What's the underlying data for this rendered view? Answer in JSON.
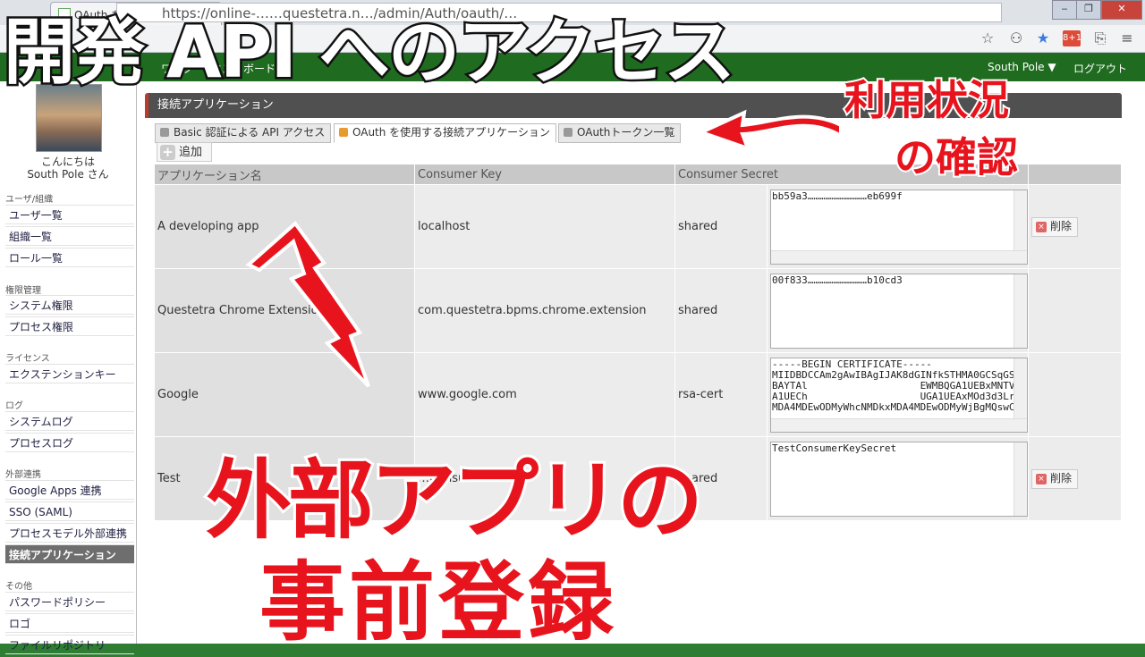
{
  "browser": {
    "tab_title": "OAuth を使用する接続ア",
    "tab_close": "×",
    "address": "https://online-……questetra.n…/admin/Auth/oauth/…",
    "window_controls": [
      "‒",
      "❐",
      "✕"
    ],
    "toolbar_icons": [
      "star-icon",
      "user-icon",
      "bookmark-star-icon",
      "gplus-icon",
      "translate-icon",
      "menu-icon"
    ],
    "gplus_label": "8+1"
  },
  "app": {
    "nav_partial": "ワーク",
    "nav_task": "タスクボード",
    "user_menu": "South Pole ▼",
    "logout": "ログアウト"
  },
  "sidebar": {
    "greeting_line1": "こんにちは",
    "greeting_line2": "South Pole さん",
    "sections": [
      {
        "title": "ユーザ/組織",
        "items": [
          "ユーザ一覧",
          "組織一覧",
          "ロール一覧"
        ]
      },
      {
        "title": "権限管理",
        "items": [
          "システム権限",
          "プロセス権限"
        ]
      },
      {
        "title": "ライセンス",
        "items": [
          "エクステンションキー"
        ]
      },
      {
        "title": "ログ",
        "items": [
          "システムログ",
          "プロセスログ"
        ]
      },
      {
        "title": "外部連携",
        "items": [
          "Google Apps 連携",
          "SSO (SAML)",
          "プロセスモデル外部連携",
          "接続アプリケーション"
        ]
      },
      {
        "title": "その他",
        "items": [
          "パスワードポリシー",
          "ロゴ",
          "ファイルリポジトリ"
        ]
      }
    ]
  },
  "main": {
    "panel_title": "接続アプリケーション",
    "tabs": [
      "Basic 認証による API アクセス",
      "OAuth を使用する接続アプリケーション",
      "OAuthトークン一覧"
    ],
    "add_label": "追加",
    "columns": [
      "アプリケーション名",
      "Consumer Key",
      "Consumer Secret"
    ],
    "rows": [
      {
        "name": "A developing app",
        "key": "localhost",
        "type": "shared",
        "secret": "bb59a3…………………………eb699f",
        "delete": "削除"
      },
      {
        "name": "Questetra Chrome Extension",
        "key": "com.questetra.bpms.chrome.extension",
        "type": "shared",
        "secret": "00f833…………………………b10cd3",
        "delete": ""
      },
      {
        "name": "Google",
        "key": "www.google.com",
        "type": "rsa-cert",
        "secret": "-----BEGIN CERTIFICATE-----\nMIIDBDCCAm2gAwIBAgIJAK8dGINfkSTHMA0GCSqGSI\nBAYTAl                   EWMBQGA1UEBxMNTV\nA1UECh                   UGA1UEAxMOd3d3Lr\nMDA4MDEwODMyWhcNMDkxMDA4MDEwODMyWjBgMQswCC",
        "delete": ""
      },
      {
        "name": "Test",
        "key": "…Consumer…",
        "type": "shared",
        "secret": "TestConsumerKeySecret",
        "delete": "削除"
      }
    ]
  },
  "captions": {
    "title": "開発 API へのアクセス",
    "usage_line1": "利用状況",
    "usage_line2": "の確認",
    "register_line1": "外部アプリの",
    "register_line2": "事前登録"
  },
  "colors": {
    "accent_red": "#e8141d",
    "header_green": "#1f6b1f",
    "panel_dark": "#505050"
  }
}
